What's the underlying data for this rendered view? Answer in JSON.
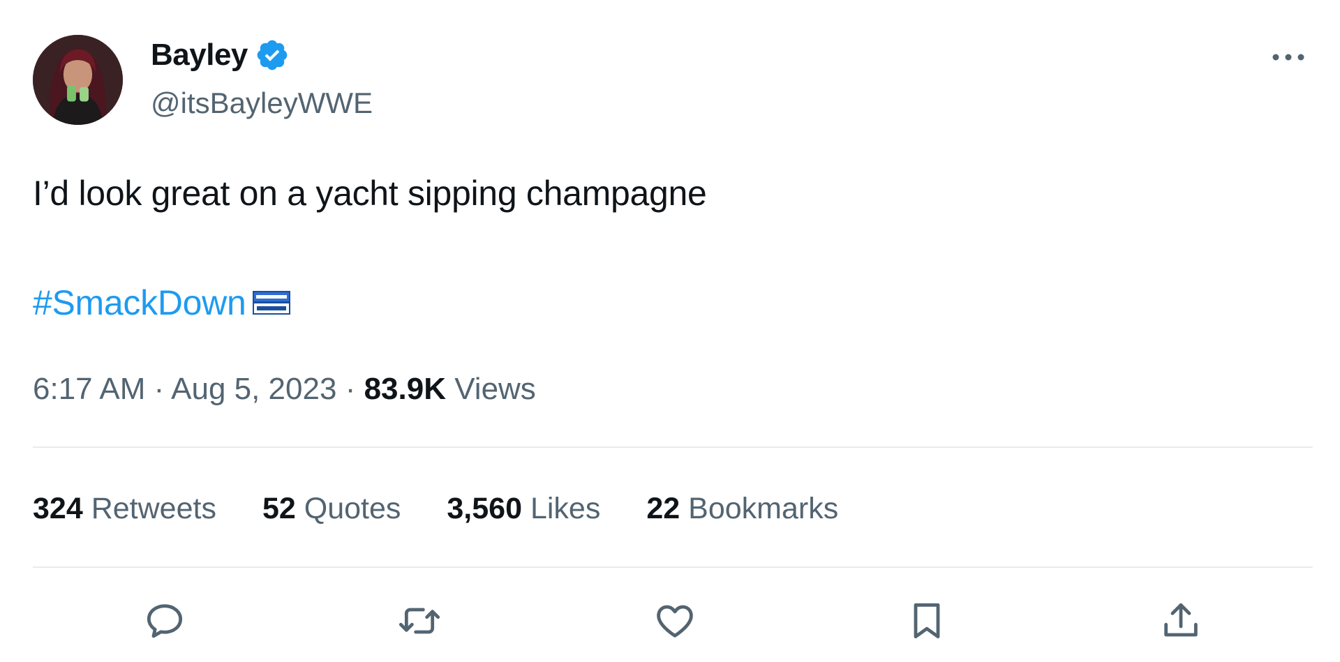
{
  "author": {
    "display_name": "Bayley",
    "handle": "@itsBayleyWWE",
    "verified": true,
    "avatar_icon": "profile-photo"
  },
  "tweet": {
    "text": "I’d look great on a yacht sipping champagne",
    "hashtag": "#SmackDown",
    "hashflag_icon": "smackdown-logo-icon"
  },
  "meta": {
    "time": "6:17 AM",
    "separator": "·",
    "date": "Aug 5, 2023",
    "views_count": "83.9K",
    "views_label": "Views"
  },
  "stats": [
    {
      "count": "324",
      "label": "Retweets"
    },
    {
      "count": "52",
      "label": "Quotes"
    },
    {
      "count": "3,560",
      "label": "Likes"
    },
    {
      "count": "22",
      "label": "Bookmarks"
    }
  ],
  "actions": [
    "reply-icon",
    "retweet-icon",
    "like-icon",
    "bookmark-icon",
    "share-icon"
  ],
  "colors": {
    "primary_text": "#0f1419",
    "secondary_text": "#536471",
    "accent_blue": "#1d9bf0",
    "divider": "#e7ebed"
  }
}
